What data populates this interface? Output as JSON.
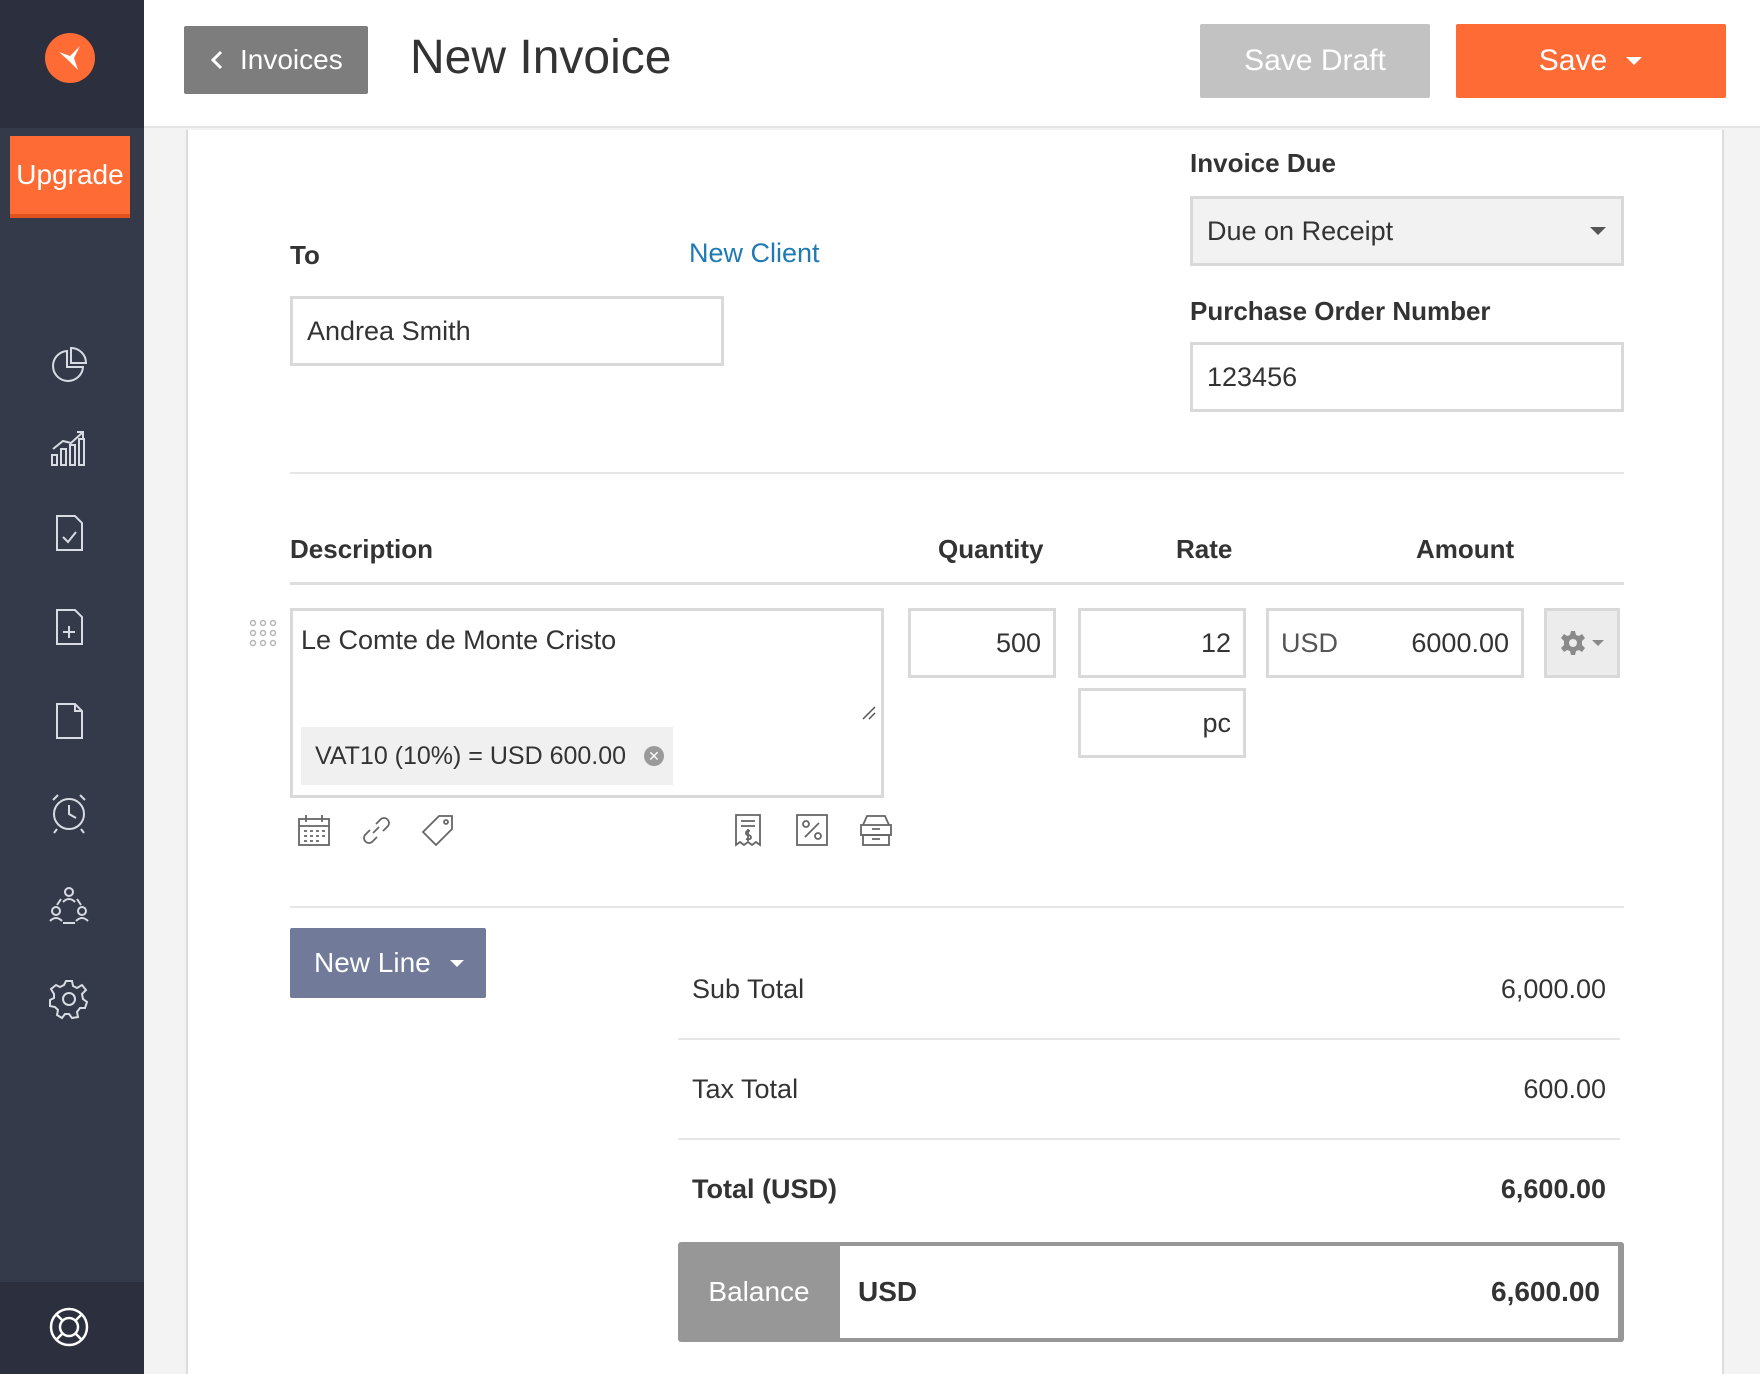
{
  "sidebar": {
    "upgrade_label": "Upgrade",
    "nav_icons": [
      "dashboard-icon",
      "reports-icon",
      "estimates-icon",
      "new-document-icon",
      "documents-icon",
      "time-tracking-icon",
      "clients-icon",
      "settings-icon"
    ],
    "help_icon": "help-lifebuoy-icon"
  },
  "header": {
    "back_label": "Invoices",
    "title": "New Invoice",
    "save_draft_label": "Save Draft",
    "save_label": "Save"
  },
  "form": {
    "to_label": "To",
    "new_client_link": "New Client",
    "to_value": "Andrea Smith",
    "invoice_due_label": "Invoice Due",
    "invoice_due_value": "Due on Receipt",
    "po_label": "Purchase Order Number",
    "po_value": "123456"
  },
  "columns": {
    "description": "Description",
    "quantity": "Quantity",
    "rate": "Rate",
    "amount": "Amount"
  },
  "line_item": {
    "description": "Le Comte de Monte Cristo",
    "tax_chip": "VAT10 (10%) = USD 600.00",
    "quantity": "500",
    "rate": "12",
    "unit": "pc",
    "currency": "USD",
    "amount": "6000.00"
  },
  "new_line_label": "New Line",
  "totals": {
    "sub_total_label": "Sub Total",
    "sub_total_value": "6,000.00",
    "tax_total_label": "Tax Total",
    "tax_total_value": "600.00",
    "total_label": "Total (USD)",
    "total_value": "6,600.00"
  },
  "balance": {
    "label": "Balance",
    "currency": "USD",
    "value": "6,600.00"
  },
  "colors": {
    "accent": "#ff6b35",
    "sidebar": "#353a4a",
    "link": "#1f7ab3",
    "new_line_button": "#717a99"
  }
}
